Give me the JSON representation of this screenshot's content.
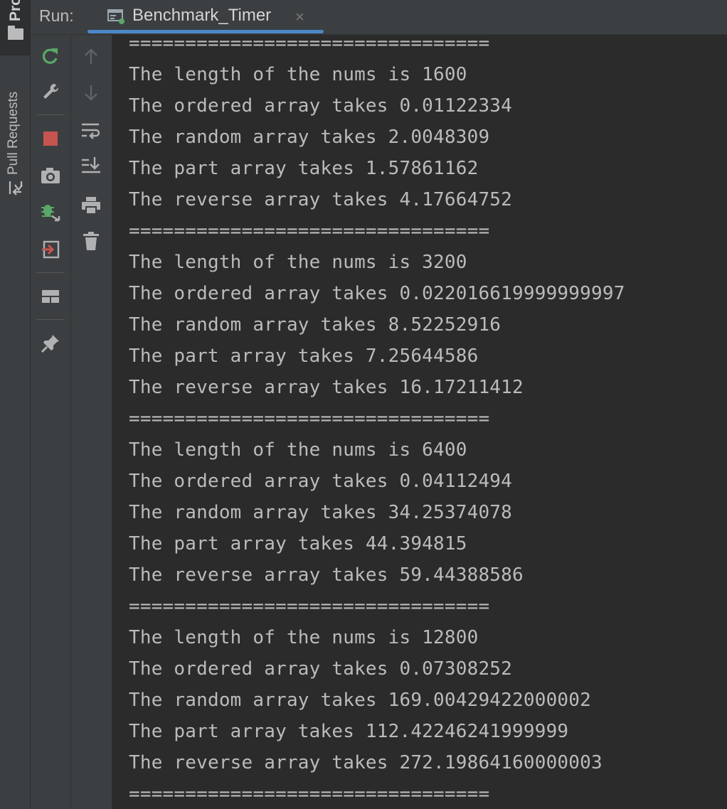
{
  "side_panel": {
    "project_tab": "Pro",
    "pull_requests_tab": "Pull Requests"
  },
  "header": {
    "run_label": "Run:",
    "tab_title": "Benchmark_Timer",
    "close_glyph": "×"
  },
  "toolbar": {
    "left": [
      "rerun-icon",
      "wrench-icon",
      "stop-icon",
      "camera-icon",
      "debug-restore-icon",
      "exit-icon",
      "layout-icon",
      "pin-icon"
    ],
    "right": [
      "arrow-up-icon",
      "arrow-down-icon",
      "soft-wrap-icon",
      "scroll-to-end-icon",
      "print-icon",
      "trash-icon"
    ]
  },
  "colors": {
    "background": "#2b2b2b",
    "panel": "#3c3f41",
    "text": "#bbbbbb",
    "accent": "#4a88c7",
    "stop": "#c75450",
    "rerun": "#59a869"
  },
  "console": {
    "lines": [
      "================================",
      "The length of the nums is 1600",
      "The ordered array takes 0.01122334",
      "The random array takes 2.0048309",
      "The part array takes 1.57861162",
      "The reverse array takes 4.17664752",
      "================================",
      "The length of the nums is 3200",
      "The ordered array takes 0.022016619999999997",
      "The random array takes 8.52252916",
      "The part array takes 7.25644586",
      "The reverse array takes 16.17211412",
      "================================",
      "The length of the nums is 6400",
      "The ordered array takes 0.04112494",
      "The random array takes 34.25374078",
      "The part array takes 44.394815",
      "The reverse array takes 59.44388586",
      "================================",
      "The length of the nums is 12800",
      "The ordered array takes 0.07308252",
      "The random array takes 169.00429422000002",
      "The part array takes 112.42246241999999",
      "The reverse array takes 272.19864160000003",
      "================================"
    ]
  }
}
